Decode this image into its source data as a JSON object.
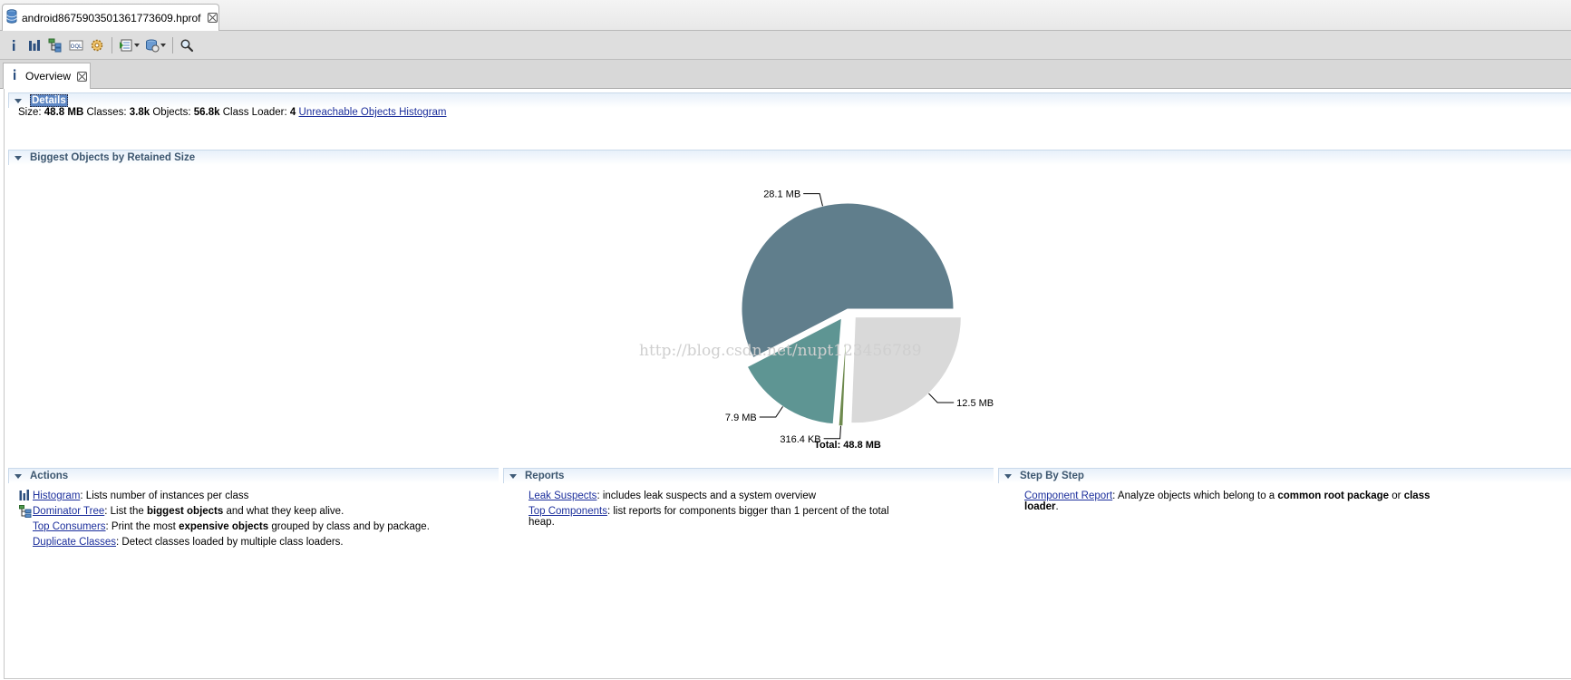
{
  "editor_tab": {
    "title": "android8675903501361773609.hprof"
  },
  "toolbar": {
    "buttons": [
      "info-icon",
      "histogram-icon",
      "dominator-tree-icon",
      "oql-icon",
      "heap-dump-details-icon",
      "run-report-icon",
      "query-browser-icon",
      "search-icon"
    ]
  },
  "inner_tab": {
    "title": "Overview"
  },
  "details": {
    "title": "Details",
    "size_label": "Size:",
    "size_value": "48.8 MB",
    "classes_label": "Classes:",
    "classes_value": "3.8k",
    "objects_label": "Objects:",
    "objects_value": "56.8k",
    "loader_label": "Class Loader:",
    "loader_value": "4",
    "link": "Unreachable Objects Histogram"
  },
  "biggest": {
    "title": "Biggest Objects by Retained Size"
  },
  "chart_data": {
    "type": "pie",
    "slices": [
      {
        "label": "28.1 MB",
        "value": 28.1,
        "color": "#607e8c",
        "exploded": false
      },
      {
        "label": "12.5 MB",
        "value": 12.5,
        "color": "#d9d9d9",
        "exploded": true
      },
      {
        "label": "316.4 KB",
        "value": 0.316,
        "color": "#6e8a4e",
        "exploded": true
      },
      {
        "label": "7.9 MB",
        "value": 7.9,
        "color": "#5e9593",
        "exploded": true
      }
    ],
    "total_label": "Total: 48.8 MB"
  },
  "watermark": "http://blog.csdn.net/nupt123456789",
  "actions": {
    "title": "Actions",
    "items": [
      {
        "link": "Histogram",
        "pre": ": Lists number of instances per class",
        "bold": "",
        "post": ""
      },
      {
        "link": "Dominator Tree",
        "pre": ": List the ",
        "bold": "biggest objects",
        "post": " and what they keep alive."
      },
      {
        "link": "Top Consumers",
        "pre": ": Print the most ",
        "bold": "expensive objects",
        "post": " grouped by class and by package."
      },
      {
        "link": "Duplicate Classes",
        "pre": ": Detect classes loaded by multiple class loaders.",
        "bold": "",
        "post": ""
      }
    ]
  },
  "reports": {
    "title": "Reports",
    "items": [
      {
        "link": "Leak Suspects",
        "text": ": includes leak suspects and a system overview"
      },
      {
        "link": "Top Components",
        "text": ": list reports for components bigger than 1 percent of the total",
        "text2": "heap."
      }
    ]
  },
  "stepbystep": {
    "title": "Step By Step",
    "link": "Component Report",
    "pre": ": Analyze objects which belong to a ",
    "bold1": "common root package",
    "mid": " or ",
    "bold2": "class",
    "bold3": "loader",
    "end": "."
  }
}
